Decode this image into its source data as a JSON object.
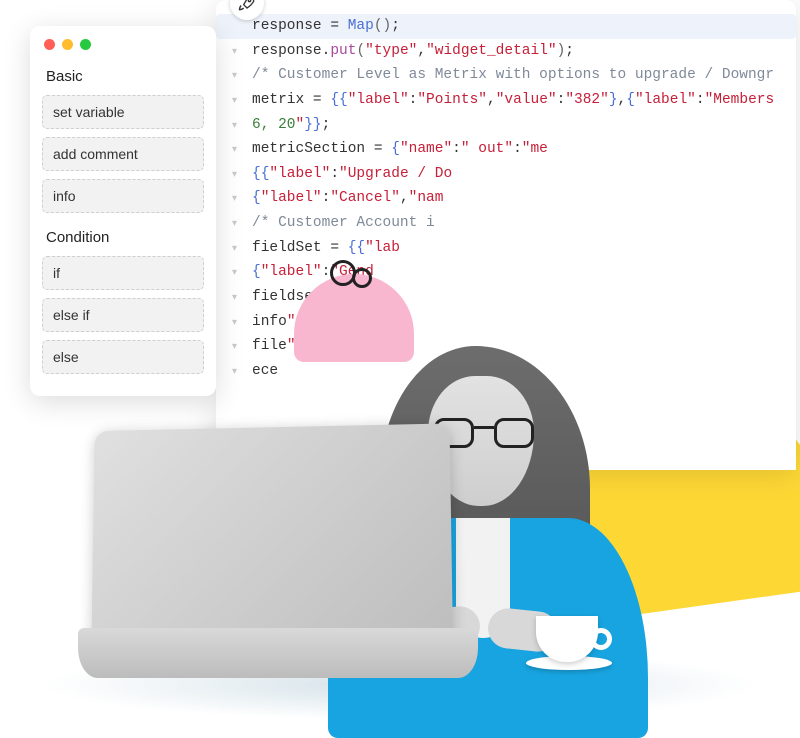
{
  "palette": {
    "sections": [
      {
        "heading": "Basic",
        "items": [
          "set variable",
          "add comment",
          "info"
        ]
      },
      {
        "heading": "Condition",
        "items": [
          "if",
          "else if",
          "else"
        ]
      }
    ]
  },
  "code": {
    "lines": [
      {
        "hl": true,
        "tokens": [
          {
            "c": "var",
            "t": "response"
          },
          {
            "c": "op",
            "t": " = "
          },
          {
            "c": "fn",
            "t": "Map"
          },
          {
            "c": "paren",
            "t": "()"
          },
          {
            "c": "op",
            "t": ";"
          }
        ]
      },
      {
        "tokens": [
          {
            "c": "var",
            "t": "response"
          },
          {
            "c": "op",
            "t": "."
          },
          {
            "c": "id",
            "t": "put"
          },
          {
            "c": "paren",
            "t": "("
          },
          {
            "c": "str",
            "t": "\"type\""
          },
          {
            "c": "op",
            "t": ","
          },
          {
            "c": "str",
            "t": "\"widget_detail\""
          },
          {
            "c": "paren",
            "t": ")"
          },
          {
            "c": "op",
            "t": ";"
          }
        ]
      },
      {
        "tokens": [
          {
            "c": "cmt",
            "t": "/* Customer Level as Metrix with options to upgrade / Downgr"
          }
        ]
      },
      {
        "tokens": [
          {
            "c": "var",
            "t": "metrix"
          },
          {
            "c": "op",
            "t": " = "
          },
          {
            "c": "brace",
            "t": "{{"
          },
          {
            "c": "str",
            "t": "\"label\""
          },
          {
            "c": "op",
            "t": ":"
          },
          {
            "c": "str",
            "t": "\"Points\""
          },
          {
            "c": "op",
            "t": ","
          },
          {
            "c": "str",
            "t": "\"value\""
          },
          {
            "c": "op",
            "t": ":"
          },
          {
            "c": "str",
            "t": "\"382\""
          },
          {
            "c": "brace",
            "t": "}"
          },
          {
            "c": "op",
            "t": ","
          },
          {
            "c": "brace",
            "t": "{"
          },
          {
            "c": "str",
            "t": "\"label\""
          },
          {
            "c": "op",
            "t": ":"
          },
          {
            "c": "str",
            "t": "\"Members"
          }
        ]
      },
      {
        "tokens": [
          {
            "c": "num",
            "t": "6, 20"
          },
          {
            "c": "str",
            "t": "\""
          },
          {
            "c": "brace",
            "t": "}}"
          },
          {
            "c": "op",
            "t": ";"
          }
        ]
      },
      {
        "tokens": [
          {
            "c": "var",
            "t": "metricSection"
          },
          {
            "c": "op",
            "t": " = "
          },
          {
            "c": "brace",
            "t": "{"
          },
          {
            "c": "str",
            "t": "\"name\""
          },
          {
            "c": "op",
            "t": ":"
          },
          {
            "c": "str",
            "t": "\""
          },
          {
            "c": "var",
            "t": "               "
          },
          {
            "c": "str",
            "t": "out\""
          },
          {
            "c": "op",
            "t": ":"
          },
          {
            "c": "str",
            "t": "\"me"
          }
        ]
      },
      {
        "tokens": [
          {
            "c": "brace",
            "t": "{{"
          },
          {
            "c": "str",
            "t": "\"label\""
          },
          {
            "c": "op",
            "t": ":"
          },
          {
            "c": "str",
            "t": "\"Upgrade / Do"
          }
        ]
      },
      {
        "tokens": [
          {
            "c": "brace",
            "t": "{"
          },
          {
            "c": "str",
            "t": "\"label\""
          },
          {
            "c": "op",
            "t": ":"
          },
          {
            "c": "str",
            "t": "\"Cancel\""
          },
          {
            "c": "op",
            "t": ","
          },
          {
            "c": "str",
            "t": "\"nam"
          }
        ]
      },
      {
        "tokens": [
          {
            "c": "cmt",
            "t": "/* Customer Account i"
          }
        ]
      },
      {
        "tokens": [
          {
            "c": "var",
            "t": "fieldSet"
          },
          {
            "c": "op",
            "t": " = "
          },
          {
            "c": "brace",
            "t": "{{"
          },
          {
            "c": "str",
            "t": "\"lab"
          }
        ]
      },
      {
        "tokens": [
          {
            "c": "brace",
            "t": "{"
          },
          {
            "c": "str",
            "t": "\"label\""
          },
          {
            "c": "op",
            "t": ":"
          },
          {
            "c": "str",
            "t": "\"Gend"
          }
        ]
      },
      {
        "tokens": [
          {
            "c": "var",
            "t": "fieldsetSe"
          }
        ]
      },
      {
        "tokens": [
          {
            "c": "var",
            "t": "info"
          },
          {
            "c": "str",
            "t": "\""
          },
          {
            "c": "op",
            "t": ","
          },
          {
            "c": "str",
            "t": "\"d"
          }
        ]
      },
      {
        "tokens": [
          {
            "c": "var",
            "t": "file"
          },
          {
            "c": "str",
            "t": "\""
          },
          {
            "c": "op",
            "t": ","
          }
        ]
      },
      {
        "tokens": [
          {
            "c": "var",
            "t": "ece"
          }
        ]
      }
    ]
  },
  "icon_labels": {
    "rocket": "rocket-icon"
  }
}
